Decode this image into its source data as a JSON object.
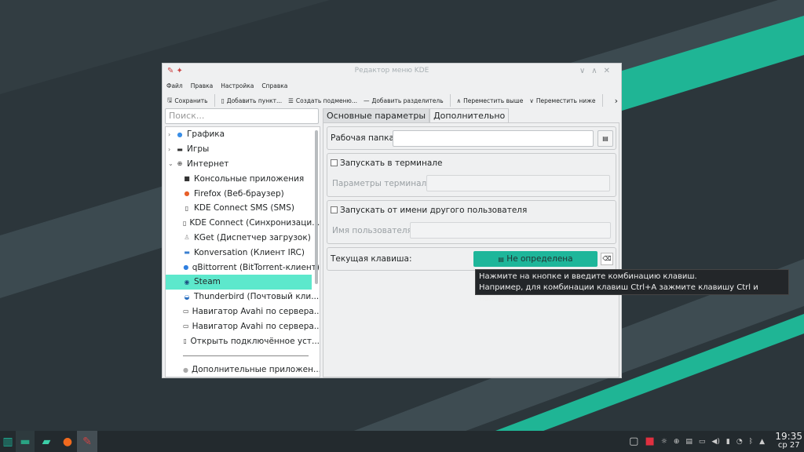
{
  "colors": {
    "accent": "#1eb69a",
    "selection": "#5de8cc",
    "desktop": "#2c363b"
  },
  "window": {
    "title": "Редактор меню KDE",
    "menu": [
      "Файл",
      "Правка",
      "Настройка",
      "Справка"
    ],
    "toolbar": {
      "save": "Сохранить",
      "add_item": "Добавить пункт...",
      "add_submenu": "Создать подменю...",
      "add_separator": "Добавить разделитель",
      "move_up": "Переместить выше",
      "move_down": "Переместить ниже"
    },
    "search_placeholder": "Поиск...",
    "tree": [
      {
        "label": "Графика",
        "icon": "graphics-icon",
        "level": 0,
        "expanded": false
      },
      {
        "label": "Игры",
        "icon": "gamepad-icon",
        "level": 0,
        "expanded": false
      },
      {
        "label": "Интернет",
        "icon": "globe-icon",
        "level": 0,
        "expanded": true
      },
      {
        "label": "Консольные приложения",
        "icon": "terminal-icon",
        "level": 1
      },
      {
        "label": "Firefox (Веб-браузер)",
        "icon": "firefox-icon",
        "level": 1
      },
      {
        "label": "KDE Connect SMS (SMS)",
        "icon": "phone-icon",
        "level": 1
      },
      {
        "label": "KDE Connect (Синхронизаци...",
        "icon": "phone-icon",
        "level": 1
      },
      {
        "label": "KGet (Диспетчер загрузок)",
        "icon": "download-icon",
        "level": 1
      },
      {
        "label": "Konversation (Клиент IRC)",
        "icon": "chat-icon",
        "level": 1
      },
      {
        "label": "qBittorrent (BitTorrent-клиент)",
        "icon": "qbittorrent-icon",
        "level": 1
      },
      {
        "label": "Steam",
        "icon": "steam-icon",
        "level": 1,
        "selected": true
      },
      {
        "label": "Thunderbird (Почтовый кли...",
        "icon": "thunderbird-icon",
        "level": 1
      },
      {
        "label": "Навигатор Avahi по сервера...",
        "icon": "network-icon",
        "level": 1
      },
      {
        "label": "Навигатор Avahi по сервера...",
        "icon": "network-icon",
        "level": 1
      },
      {
        "label": "Открыть подключённое уст...",
        "icon": "phone-icon",
        "level": 1
      }
    ],
    "tree_after_separator": {
      "label": "Дополнительные приложен...",
      "icon": "apps-icon"
    },
    "tabs": [
      "Основные параметры",
      "Дополнительно"
    ],
    "active_tab": 1,
    "advanced": {
      "work_dir_label": "Рабочая папка:",
      "work_dir_value": "",
      "run_in_terminal": "Запускать в терминале",
      "run_in_terminal_checked": false,
      "terminal_options_label": "Параметры терминала:",
      "run_as_other": "Запускать от имени другого пользователя",
      "run_as_other_checked": false,
      "username_label": "Имя пользователя:",
      "shortcut_label": "Текущая клавиша:",
      "shortcut_value": "Не определена"
    },
    "tooltip": [
      "Нажмите на кнопке и введите комбинацию клавиш.",
      "Например, для комбинации клавиш Ctrl+A зажмите клавишу Ctrl и нажмите A."
    ]
  },
  "taskbar": {
    "time": "19:35",
    "date": "ср 27"
  }
}
